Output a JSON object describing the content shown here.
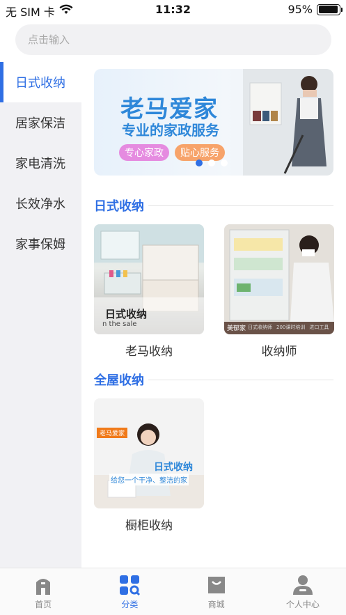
{
  "status_bar": {
    "carrier": "无 SIM 卡",
    "time": "11:32",
    "battery": "95%",
    "battery_level": 0.95
  },
  "search": {
    "placeholder": "点击输入"
  },
  "sidebar": {
    "items": [
      {
        "label": "日式收纳",
        "active": true
      },
      {
        "label": "居家保洁",
        "active": false
      },
      {
        "label": "家电清洗",
        "active": false
      },
      {
        "label": "长效净水",
        "active": false
      },
      {
        "label": "家事保姆",
        "active": false
      }
    ]
  },
  "banner": {
    "title": "老马爱家",
    "subtitle": "专业的家政服务",
    "tag1": "专心家政",
    "tag2": "贴心服务",
    "slide_count": 3,
    "active_slide": 1
  },
  "sections": [
    {
      "title": "日式收纳",
      "cards": [
        {
          "label": "老马收纳",
          "overlay_title": "日式收纳",
          "overlay_sub": "n the sale"
        },
        {
          "label": "收纳师",
          "overlay_brand": "美郁家",
          "overlay_tags": [
            "日式收纳师",
            "200课时培训",
            "进口工具"
          ]
        }
      ]
    },
    {
      "title": "全屋收纳",
      "cards": [
        {
          "label": "橱柜收纳",
          "overlay_brand": "老马爱家",
          "overlay_title": "日式收纳",
          "overlay_sub": "给您一个干净、整洁的家"
        }
      ]
    }
  ],
  "tabbar": {
    "items": [
      {
        "label": "首页",
        "icon": "home-icon",
        "active": false
      },
      {
        "label": "分类",
        "icon": "category-icon",
        "active": true
      },
      {
        "label": "商城",
        "icon": "shop-bag-icon",
        "active": false
      },
      {
        "label": "个人中心",
        "icon": "user-icon",
        "active": false
      }
    ]
  },
  "colors": {
    "accent": "#2f6fe4",
    "banner_text": "#2e87d9",
    "inactive": "#888888"
  }
}
